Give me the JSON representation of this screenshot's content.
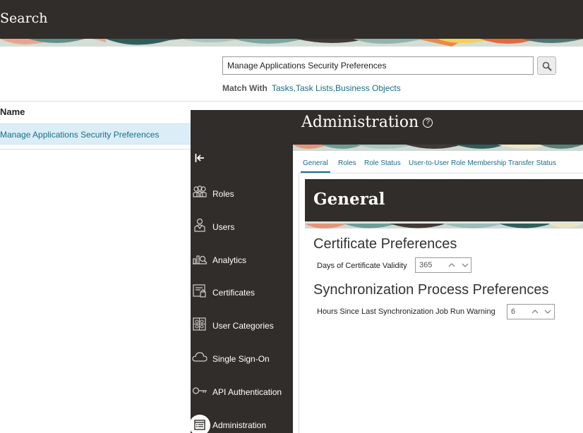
{
  "header": {
    "title": "Search"
  },
  "search": {
    "value": "Manage Applications Security Preferences",
    "match_with_label": "Match With",
    "match_with_value": "Tasks,Task Lists,Business Objects",
    "icon": "search-icon"
  },
  "results": {
    "column_header": "Name",
    "rows": [
      {
        "label": "Manage Applications Security Preferences"
      }
    ]
  },
  "admin": {
    "title": "Administration",
    "help_glyph": "?",
    "nav": [
      {
        "label": "Roles",
        "icon": "roles-icon"
      },
      {
        "label": "Users",
        "icon": "users-icon"
      },
      {
        "label": "Analytics",
        "icon": "analytics-icon"
      },
      {
        "label": "Certificates",
        "icon": "certificates-icon"
      },
      {
        "label": "User Categories",
        "icon": "user-categories-icon"
      },
      {
        "label": "Single Sign-On",
        "icon": "cloud-icon"
      },
      {
        "label": "API Authentication",
        "icon": "key-icon"
      },
      {
        "label": "Administration",
        "icon": "administration-icon",
        "active": true
      }
    ],
    "tabs": [
      {
        "label": "General",
        "active": true
      },
      {
        "label": "Roles"
      },
      {
        "label": "Role Status"
      },
      {
        "label": "User-to-User Role Membership Transfer Status"
      }
    ],
    "panel": {
      "title": "General",
      "sections": [
        {
          "title": "Certificate Preferences",
          "field_label": "Days of Certificate Validity",
          "value": "365"
        },
        {
          "title": "Synchronization Process Preferences",
          "field_label": "Hours Since Last Synchronization Job Run Warning",
          "value": "6"
        }
      ]
    }
  },
  "colors": {
    "dark": "#312d2a",
    "link": "#1b6c88",
    "selected_row": "#dbeef8"
  }
}
